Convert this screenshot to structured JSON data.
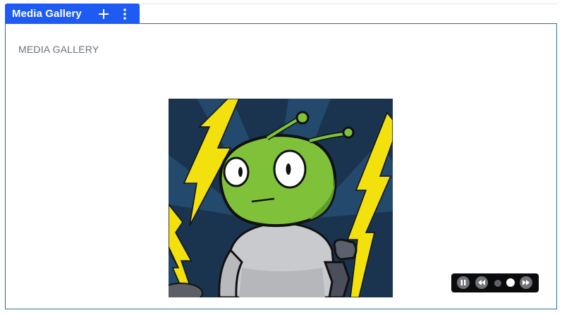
{
  "block": {
    "title": "Media Gallery",
    "heading": "MEDIA GALLERY"
  },
  "toolbar": {
    "add_icon": "plus-icon",
    "more_icon": "vertical-dots-icon"
  },
  "gallery": {
    "image_alt": "green alien cartoon character",
    "slide_count": 2,
    "active_slide": 2
  },
  "controls": {
    "pause_icon": "pause-icon",
    "prev_icon": "rewind-icon",
    "next_icon": "fast-forward-icon"
  },
  "colors": {
    "accent": "#1e5bf2",
    "frame": "#2a6f9c",
    "controls_bg": "#0b0b0d"
  }
}
